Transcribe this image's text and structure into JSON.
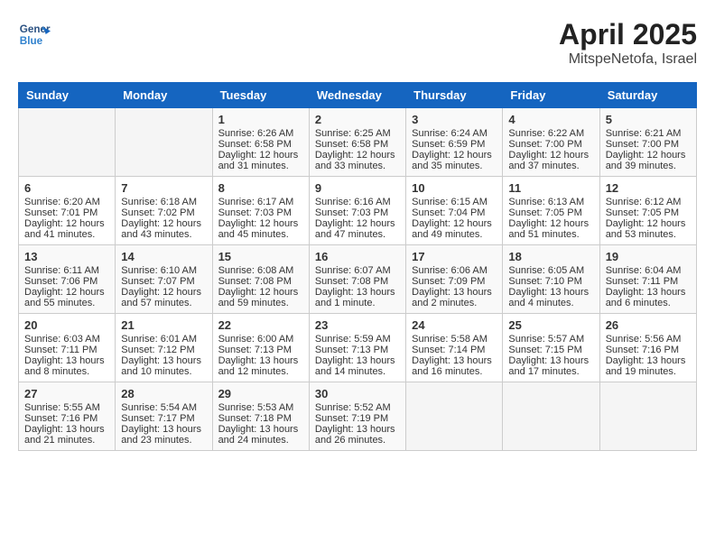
{
  "header": {
    "logo_line1": "General",
    "logo_line2": "Blue",
    "title": "April 2025",
    "subtitle": "MitspeNetofa, Israel"
  },
  "weekdays": [
    "Sunday",
    "Monday",
    "Tuesday",
    "Wednesday",
    "Thursday",
    "Friday",
    "Saturday"
  ],
  "weeks": [
    [
      {
        "day": "",
        "empty": true
      },
      {
        "day": "",
        "empty": true
      },
      {
        "day": "1",
        "sunrise": "Sunrise: 6:26 AM",
        "sunset": "Sunset: 6:58 PM",
        "daylight": "Daylight: 12 hours and 31 minutes."
      },
      {
        "day": "2",
        "sunrise": "Sunrise: 6:25 AM",
        "sunset": "Sunset: 6:58 PM",
        "daylight": "Daylight: 12 hours and 33 minutes."
      },
      {
        "day": "3",
        "sunrise": "Sunrise: 6:24 AM",
        "sunset": "Sunset: 6:59 PM",
        "daylight": "Daylight: 12 hours and 35 minutes."
      },
      {
        "day": "4",
        "sunrise": "Sunrise: 6:22 AM",
        "sunset": "Sunset: 7:00 PM",
        "daylight": "Daylight: 12 hours and 37 minutes."
      },
      {
        "day": "5",
        "sunrise": "Sunrise: 6:21 AM",
        "sunset": "Sunset: 7:00 PM",
        "daylight": "Daylight: 12 hours and 39 minutes."
      }
    ],
    [
      {
        "day": "6",
        "sunrise": "Sunrise: 6:20 AM",
        "sunset": "Sunset: 7:01 PM",
        "daylight": "Daylight: 12 hours and 41 minutes."
      },
      {
        "day": "7",
        "sunrise": "Sunrise: 6:18 AM",
        "sunset": "Sunset: 7:02 PM",
        "daylight": "Daylight: 12 hours and 43 minutes."
      },
      {
        "day": "8",
        "sunrise": "Sunrise: 6:17 AM",
        "sunset": "Sunset: 7:03 PM",
        "daylight": "Daylight: 12 hours and 45 minutes."
      },
      {
        "day": "9",
        "sunrise": "Sunrise: 6:16 AM",
        "sunset": "Sunset: 7:03 PM",
        "daylight": "Daylight: 12 hours and 47 minutes."
      },
      {
        "day": "10",
        "sunrise": "Sunrise: 6:15 AM",
        "sunset": "Sunset: 7:04 PM",
        "daylight": "Daylight: 12 hours and 49 minutes."
      },
      {
        "day": "11",
        "sunrise": "Sunrise: 6:13 AM",
        "sunset": "Sunset: 7:05 PM",
        "daylight": "Daylight: 12 hours and 51 minutes."
      },
      {
        "day": "12",
        "sunrise": "Sunrise: 6:12 AM",
        "sunset": "Sunset: 7:05 PM",
        "daylight": "Daylight: 12 hours and 53 minutes."
      }
    ],
    [
      {
        "day": "13",
        "sunrise": "Sunrise: 6:11 AM",
        "sunset": "Sunset: 7:06 PM",
        "daylight": "Daylight: 12 hours and 55 minutes."
      },
      {
        "day": "14",
        "sunrise": "Sunrise: 6:10 AM",
        "sunset": "Sunset: 7:07 PM",
        "daylight": "Daylight: 12 hours and 57 minutes."
      },
      {
        "day": "15",
        "sunrise": "Sunrise: 6:08 AM",
        "sunset": "Sunset: 7:08 PM",
        "daylight": "Daylight: 12 hours and 59 minutes."
      },
      {
        "day": "16",
        "sunrise": "Sunrise: 6:07 AM",
        "sunset": "Sunset: 7:08 PM",
        "daylight": "Daylight: 13 hours and 1 minute."
      },
      {
        "day": "17",
        "sunrise": "Sunrise: 6:06 AM",
        "sunset": "Sunset: 7:09 PM",
        "daylight": "Daylight: 13 hours and 2 minutes."
      },
      {
        "day": "18",
        "sunrise": "Sunrise: 6:05 AM",
        "sunset": "Sunset: 7:10 PM",
        "daylight": "Daylight: 13 hours and 4 minutes."
      },
      {
        "day": "19",
        "sunrise": "Sunrise: 6:04 AM",
        "sunset": "Sunset: 7:11 PM",
        "daylight": "Daylight: 13 hours and 6 minutes."
      }
    ],
    [
      {
        "day": "20",
        "sunrise": "Sunrise: 6:03 AM",
        "sunset": "Sunset: 7:11 PM",
        "daylight": "Daylight: 13 hours and 8 minutes."
      },
      {
        "day": "21",
        "sunrise": "Sunrise: 6:01 AM",
        "sunset": "Sunset: 7:12 PM",
        "daylight": "Daylight: 13 hours and 10 minutes."
      },
      {
        "day": "22",
        "sunrise": "Sunrise: 6:00 AM",
        "sunset": "Sunset: 7:13 PM",
        "daylight": "Daylight: 13 hours and 12 minutes."
      },
      {
        "day": "23",
        "sunrise": "Sunrise: 5:59 AM",
        "sunset": "Sunset: 7:13 PM",
        "daylight": "Daylight: 13 hours and 14 minutes."
      },
      {
        "day": "24",
        "sunrise": "Sunrise: 5:58 AM",
        "sunset": "Sunset: 7:14 PM",
        "daylight": "Daylight: 13 hours and 16 minutes."
      },
      {
        "day": "25",
        "sunrise": "Sunrise: 5:57 AM",
        "sunset": "Sunset: 7:15 PM",
        "daylight": "Daylight: 13 hours and 17 minutes."
      },
      {
        "day": "26",
        "sunrise": "Sunrise: 5:56 AM",
        "sunset": "Sunset: 7:16 PM",
        "daylight": "Daylight: 13 hours and 19 minutes."
      }
    ],
    [
      {
        "day": "27",
        "sunrise": "Sunrise: 5:55 AM",
        "sunset": "Sunset: 7:16 PM",
        "daylight": "Daylight: 13 hours and 21 minutes."
      },
      {
        "day": "28",
        "sunrise": "Sunrise: 5:54 AM",
        "sunset": "Sunset: 7:17 PM",
        "daylight": "Daylight: 13 hours and 23 minutes."
      },
      {
        "day": "29",
        "sunrise": "Sunrise: 5:53 AM",
        "sunset": "Sunset: 7:18 PM",
        "daylight": "Daylight: 13 hours and 24 minutes."
      },
      {
        "day": "30",
        "sunrise": "Sunrise: 5:52 AM",
        "sunset": "Sunset: 7:19 PM",
        "daylight": "Daylight: 13 hours and 26 minutes."
      },
      {
        "day": "",
        "empty": true
      },
      {
        "day": "",
        "empty": true
      },
      {
        "day": "",
        "empty": true
      }
    ]
  ]
}
